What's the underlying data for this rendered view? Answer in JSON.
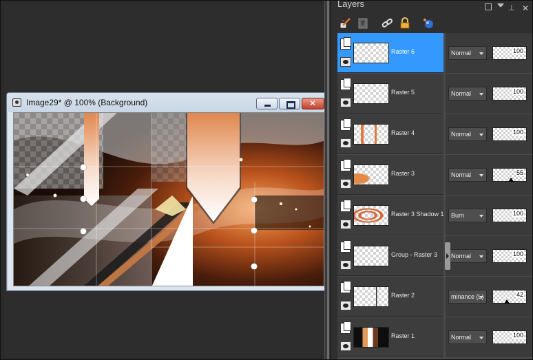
{
  "image_window": {
    "title": "Image29* @ 100% (Background)"
  },
  "layers_panel": {
    "title": "Layers",
    "toolbar_icons": [
      "paint-brush-icon",
      "mask-icon",
      "link-icon",
      "lock-icon",
      "sphere-icon"
    ],
    "layers": [
      {
        "name": "Raster 6",
        "blend_mode": "Normal",
        "opacity": "100",
        "opacity_fraction": 1.0,
        "selected": true
      },
      {
        "name": "Raster 5",
        "blend_mode": "Normal",
        "opacity": "100",
        "opacity_fraction": 1.0,
        "selected": false
      },
      {
        "name": "Raster 4",
        "blend_mode": "Normal",
        "opacity": "100",
        "opacity_fraction": 1.0,
        "selected": false
      },
      {
        "name": "Raster 3",
        "blend_mode": "Normal",
        "opacity": "55",
        "opacity_fraction": 0.55,
        "selected": false
      },
      {
        "name": "Raster 3 Shadow 1",
        "blend_mode": "Burn",
        "opacity": "100",
        "opacity_fraction": 1.0,
        "selected": false
      },
      {
        "name": "Group - Raster 3",
        "blend_mode": "Normal",
        "opacity": "100",
        "opacity_fraction": 1.0,
        "selected": false
      },
      {
        "name": "Raster 2",
        "blend_mode": "minance (L)",
        "opacity": "42",
        "opacity_fraction": 0.42,
        "selected": false
      },
      {
        "name": "Raster 1",
        "blend_mode": "Normal",
        "opacity": "100",
        "opacity_fraction": 1.0,
        "selected": false
      }
    ]
  },
  "colors": {
    "selection": "#3399ff",
    "accent_orange": "#c8602a",
    "panel_bg": "#2f2f2f"
  }
}
